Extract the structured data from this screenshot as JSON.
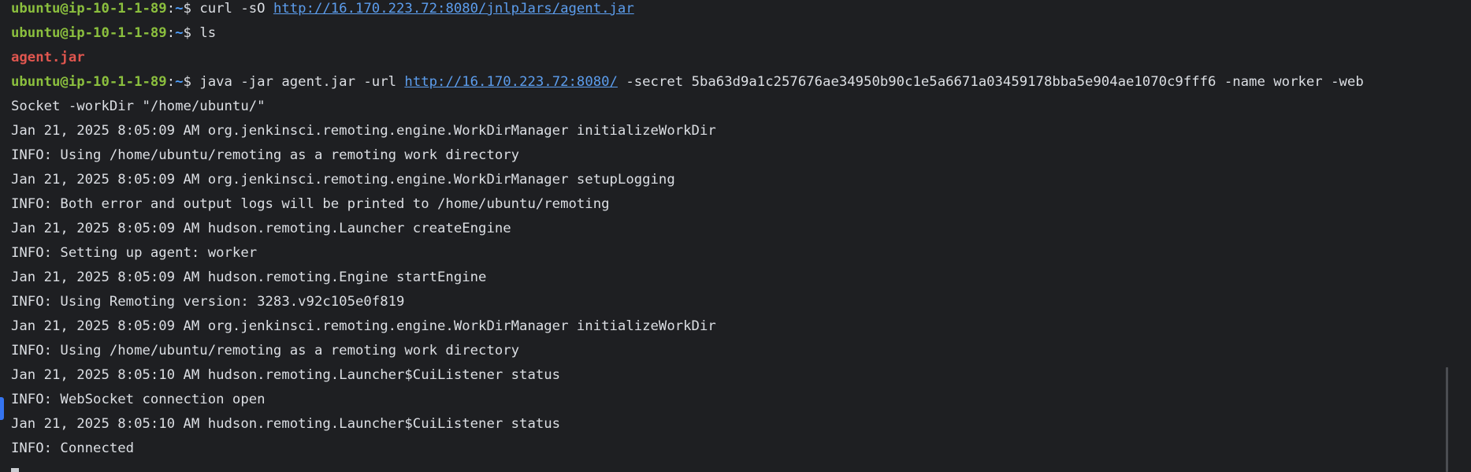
{
  "prompt": {
    "user_host": "ubuntu@ip-10-1-1-89",
    "colon": ":",
    "path": "~",
    "dollar": "$ "
  },
  "lines": [
    {
      "type": "cmd",
      "cmd": "curl -sO ",
      "link": "http://16.170.223.72:8080/jnlpJars/agent.jar",
      "rest": ""
    },
    {
      "type": "cmd",
      "cmd": "ls",
      "link": "",
      "rest": ""
    },
    {
      "type": "file",
      "text": "agent.jar"
    },
    {
      "type": "cmd",
      "cmd": "java -jar agent.jar -url ",
      "link": "http://16.170.223.72:8080/",
      "rest": " -secret 5ba63d9a1c257676ae34950b90c1e5a6671a03459178bba5e904ae1070c9fff6 -name worker -web"
    },
    {
      "type": "out",
      "text": "Socket -workDir \"/home/ubuntu/\""
    },
    {
      "type": "out",
      "text": "Jan 21, 2025 8:05:09 AM org.jenkinsci.remoting.engine.WorkDirManager initializeWorkDir"
    },
    {
      "type": "out",
      "text": "INFO: Using /home/ubuntu/remoting as a remoting work directory"
    },
    {
      "type": "out",
      "text": "Jan 21, 2025 8:05:09 AM org.jenkinsci.remoting.engine.WorkDirManager setupLogging"
    },
    {
      "type": "out",
      "text": "INFO: Both error and output logs will be printed to /home/ubuntu/remoting"
    },
    {
      "type": "out",
      "text": "Jan 21, 2025 8:05:09 AM hudson.remoting.Launcher createEngine"
    },
    {
      "type": "out",
      "text": "INFO: Setting up agent: worker"
    },
    {
      "type": "out",
      "text": "Jan 21, 2025 8:05:09 AM hudson.remoting.Engine startEngine"
    },
    {
      "type": "out",
      "text": "INFO: Using Remoting version: 3283.v92c105e0f819"
    },
    {
      "type": "out",
      "text": "Jan 21, 2025 8:05:09 AM org.jenkinsci.remoting.engine.WorkDirManager initializeWorkDir"
    },
    {
      "type": "out",
      "text": "INFO: Using /home/ubuntu/remoting as a remoting work directory"
    },
    {
      "type": "out",
      "text": "Jan 21, 2025 8:05:10 AM hudson.remoting.Launcher$CuiListener status"
    },
    {
      "type": "out",
      "text": "INFO: WebSocket connection open"
    },
    {
      "type": "out",
      "text": "Jan 21, 2025 8:05:10 AM hudson.remoting.Launcher$CuiListener status"
    },
    {
      "type": "out",
      "text": "INFO: Connected"
    }
  ],
  "colors": {
    "background": "#1e1f22",
    "prompt_user": "#8bbf3e",
    "prompt_path": "#4fa0ff",
    "link": "#5c9ded",
    "file_highlight": "#e0564f",
    "text": "#dcdfe4"
  }
}
